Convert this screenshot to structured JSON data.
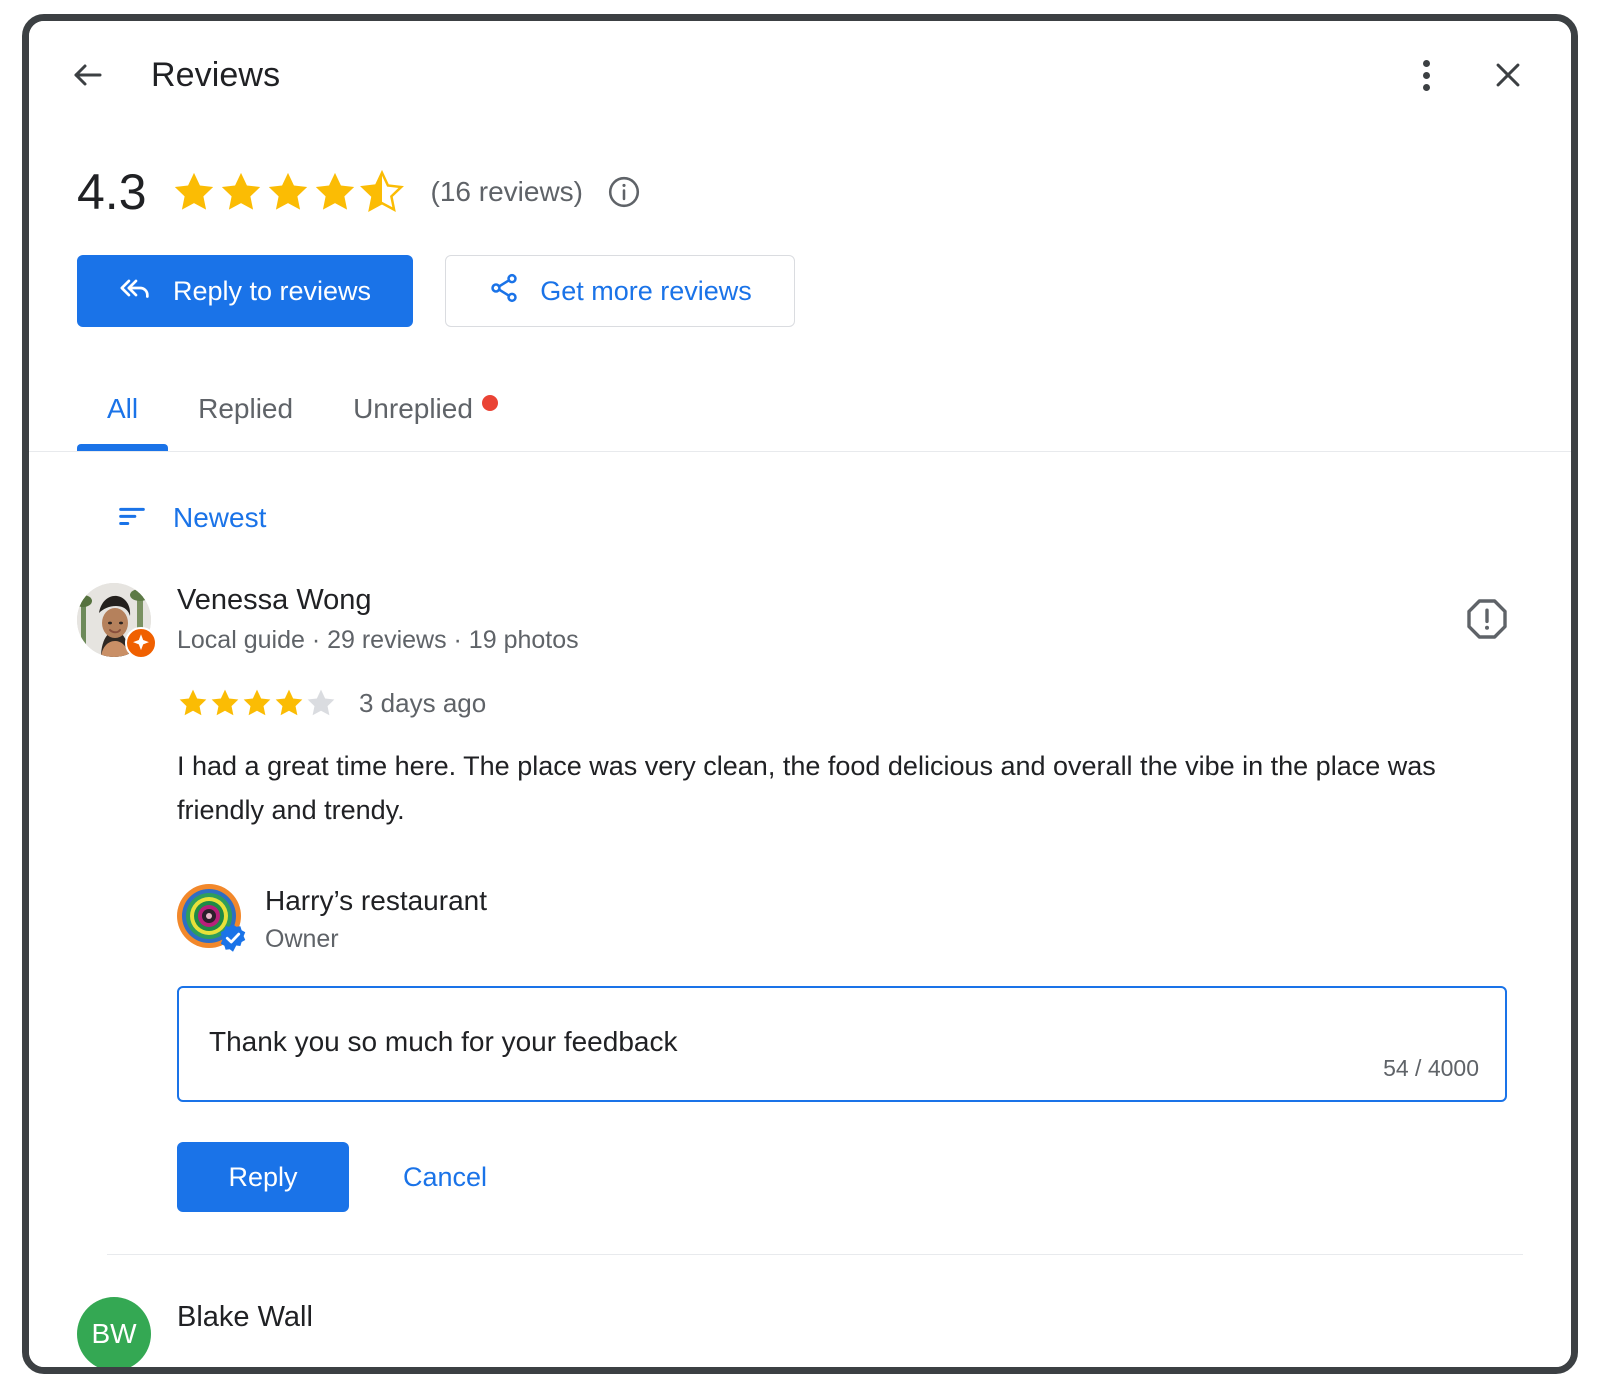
{
  "window": {
    "title": "Reviews",
    "back_icon": "arrow-back-icon",
    "more_icon": "more-options-icon",
    "close_icon": "close-icon"
  },
  "summary": {
    "rating": "4.3",
    "stars_filled": 4,
    "has_half_star": true,
    "reviews_count_label": "(16 reviews)",
    "info_icon": "info-icon"
  },
  "actions": {
    "reply_to_reviews": "Reply to reviews",
    "reply_icon": "reply-all-icon",
    "get_more_reviews": "Get more reviews",
    "share_icon": "share-icon"
  },
  "tabs": [
    {
      "label": "All",
      "active": true,
      "badge": false
    },
    {
      "label": "Replied",
      "active": false,
      "badge": false
    },
    {
      "label": "Unreplied",
      "active": false,
      "badge": true
    }
  ],
  "sort": {
    "label": "Newest",
    "icon": "sort-icon"
  },
  "reviews": [
    {
      "reviewer_name": "Venessa Wong",
      "reviewer_meta": "Local guide · 29 reviews · 19 photos",
      "stars": 4,
      "stars_total": 5,
      "date": "3 days ago",
      "text": "I had a great time here. The place was very clean, the food delicious and overall the vibe in the place was friendly and trendy.",
      "report_icon": "report-icon",
      "owner": {
        "name": "Harry’s restaurant",
        "role": "Owner",
        "verified_icon": "verified-badge-icon"
      },
      "reply": {
        "value": "Thank you so much for your feedback",
        "char_count": "54 / 4000",
        "submit_label": "Reply",
        "cancel_label": "Cancel"
      }
    },
    {
      "reviewer_name": "Blake Wall",
      "initials": "BW",
      "avatar_color": "#34a853"
    }
  ],
  "colors": {
    "accent": "#1a73e8",
    "star": "#fbbc04",
    "star_empty": "#dadce0",
    "badge_red": "#ea4335",
    "text_primary": "#202124",
    "text_secondary": "#5f6368",
    "local_guide_orange": "#f06000"
  }
}
